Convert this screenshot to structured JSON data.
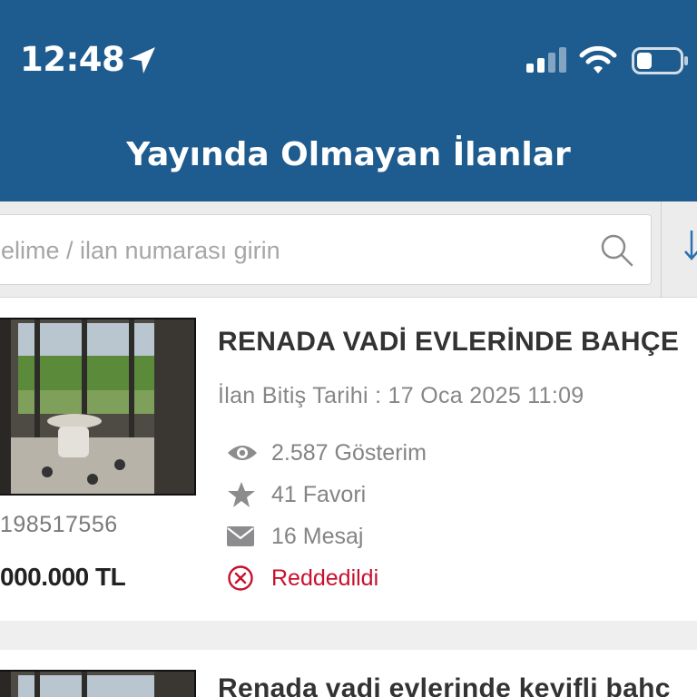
{
  "status_bar": {
    "time": "12:48",
    "icons": [
      "location-arrow-icon",
      "signal-icon",
      "wifi-icon",
      "battery-icon"
    ]
  },
  "header": {
    "title": "Yayında Olmayan İlanlar",
    "background": "#1e5b8e"
  },
  "search": {
    "placeholder": "elime / ilan numarası girin",
    "icon": "search-icon",
    "sort_icon": "sort-arrow-icon"
  },
  "listings": [
    {
      "title": "RENADA VADİ EVLERİNDE BAHÇE",
      "end_date": "İlan Bitiş Tarihi : 17 Oca 2025 11:09",
      "views": "2.587 Gösterim",
      "favorites": "41 Favori",
      "messages": "16 Mesaj",
      "status": "Reddedildi",
      "listing_id": "198517556",
      "price": "000.000 TL"
    },
    {
      "title": "Renada vadi evlerinde keyifli bahç"
    }
  ],
  "colors": {
    "accent": "#1e5b8e",
    "rejected": "#c8102e",
    "muted_text": "#848486"
  }
}
